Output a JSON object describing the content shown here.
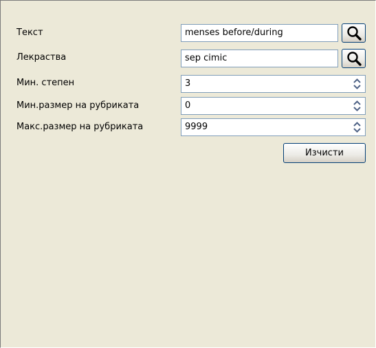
{
  "form": {
    "text": {
      "label": "Текст",
      "value": "menses before/during",
      "search_icon": "magnifier-icon"
    },
    "remedies": {
      "label": "Лекраства",
      "value": "sep cimic",
      "search_icon": "magnifier-icon"
    },
    "min_degree": {
      "label": "Мин. степен",
      "value": "3"
    },
    "min_rubric_size": {
      "label": "Мин.размер на рубриката",
      "value": "0"
    },
    "max_rubric_size": {
      "label": "Макс.размер на рубриката",
      "value": "9999"
    },
    "clear_label": "Изчисти"
  },
  "colors": {
    "background": "#ece9d8",
    "field_border": "#7f9db9",
    "button_border": "#003c74",
    "spinner_arrow": "#4d6185"
  }
}
